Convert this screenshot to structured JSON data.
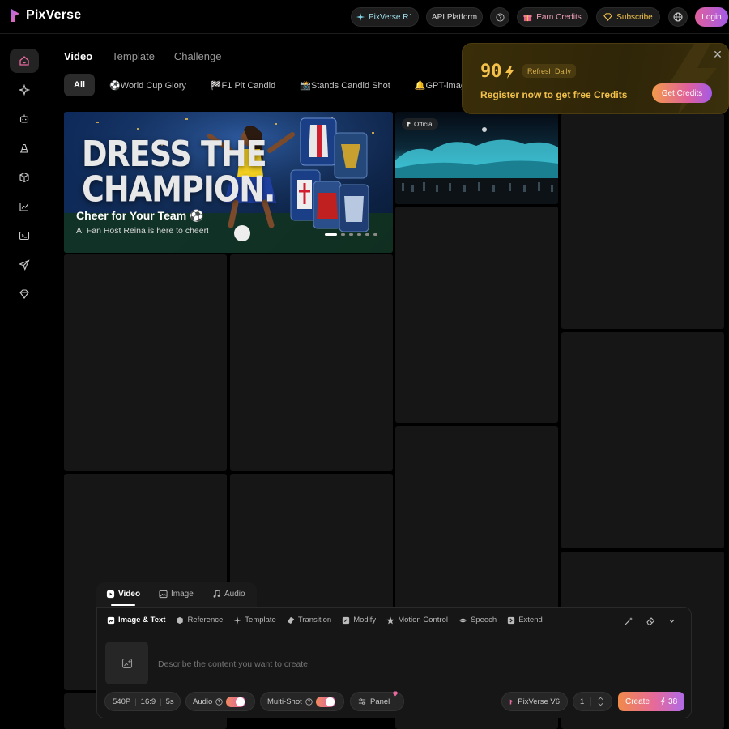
{
  "app": {
    "name": "PixVerse",
    "header": {
      "r1_label": "PixVerse R1",
      "api_label": "API Platform",
      "earn_label": "Earn Credits",
      "subscribe_label": "Subscribe",
      "login_label": "Login"
    }
  },
  "sidebar": {
    "items": [
      {
        "icon": "home-icon",
        "active": true
      },
      {
        "icon": "sparkle-icon"
      },
      {
        "icon": "robot-icon"
      },
      {
        "icon": "font-icon"
      },
      {
        "icon": "cube-icon"
      },
      {
        "icon": "chart-icon"
      },
      {
        "icon": "terminal-icon"
      },
      {
        "icon": "send-icon"
      },
      {
        "icon": "tag-icon"
      }
    ]
  },
  "main": {
    "tabs": [
      {
        "label": "Video",
        "active": true
      },
      {
        "label": "Template"
      },
      {
        "label": "Challenge"
      }
    ],
    "chips": [
      {
        "label": "All",
        "active": true
      },
      {
        "label": "⚽World Cup Glory"
      },
      {
        "label": "🏁F1 Pit Candid"
      },
      {
        "label": "📸Stands Candid Shot"
      },
      {
        "label": "🔔GPT-image"
      }
    ],
    "banner": {
      "title_line1": "DRESS THE",
      "title_line2": "CHAMPION.",
      "headline": "Cheer for Your Team ⚽",
      "subline": "AI Fan Host Reina is here to cheer!"
    },
    "official_badge": "Official"
  },
  "credits_popup": {
    "amount": "90",
    "refresh": "Refresh Daily",
    "message": "Register now to get free Credits",
    "button": "Get Credits"
  },
  "composer": {
    "tabs": [
      {
        "label": "Video",
        "active": true
      },
      {
        "label": "Image"
      },
      {
        "label": "Audio"
      }
    ],
    "modes": [
      {
        "label": "Image & Text",
        "active": true
      },
      {
        "label": "Reference"
      },
      {
        "label": "Template"
      },
      {
        "label": "Transition"
      },
      {
        "label": "Modify"
      },
      {
        "label": "Motion Control"
      },
      {
        "label": "Speech"
      },
      {
        "label": "Extend"
      }
    ],
    "placeholder": "Describe the content you want to create",
    "quality": "540P",
    "ratio": "16:9",
    "duration": "5s",
    "audio_label": "Audio",
    "multishot_label": "Multi-Shot",
    "panel_label": "Panel",
    "model_label": "PixVerse V6",
    "count": "1",
    "create_label": "Create",
    "create_cost": "38"
  },
  "colors": {
    "accent_gold": "#f4c24a",
    "gradient_start": "#f08a4a",
    "gradient_end": "#b06ae8"
  }
}
